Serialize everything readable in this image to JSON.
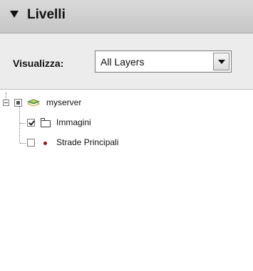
{
  "panel": {
    "title": "Livelli",
    "collapse_icon": "triangle-down-icon"
  },
  "controls": {
    "visualizza_label": "Visualizza:",
    "layer_filter_value": "All Layers"
  },
  "tree": {
    "nodes": [
      {
        "label": "myserver",
        "checkbox": "partial",
        "icon": "layers-icon",
        "expanded": true
      },
      {
        "label": "Immagini",
        "checkbox": "checked",
        "icon": "folder-icon"
      },
      {
        "label": "Strade Principali",
        "checkbox": "unchecked",
        "icon": "point-symbol-icon",
        "symbol_color": "#8b1c1c"
      }
    ]
  },
  "colors": {
    "header_bg": "#cfcfcf",
    "controls_bg": "#ececec"
  }
}
